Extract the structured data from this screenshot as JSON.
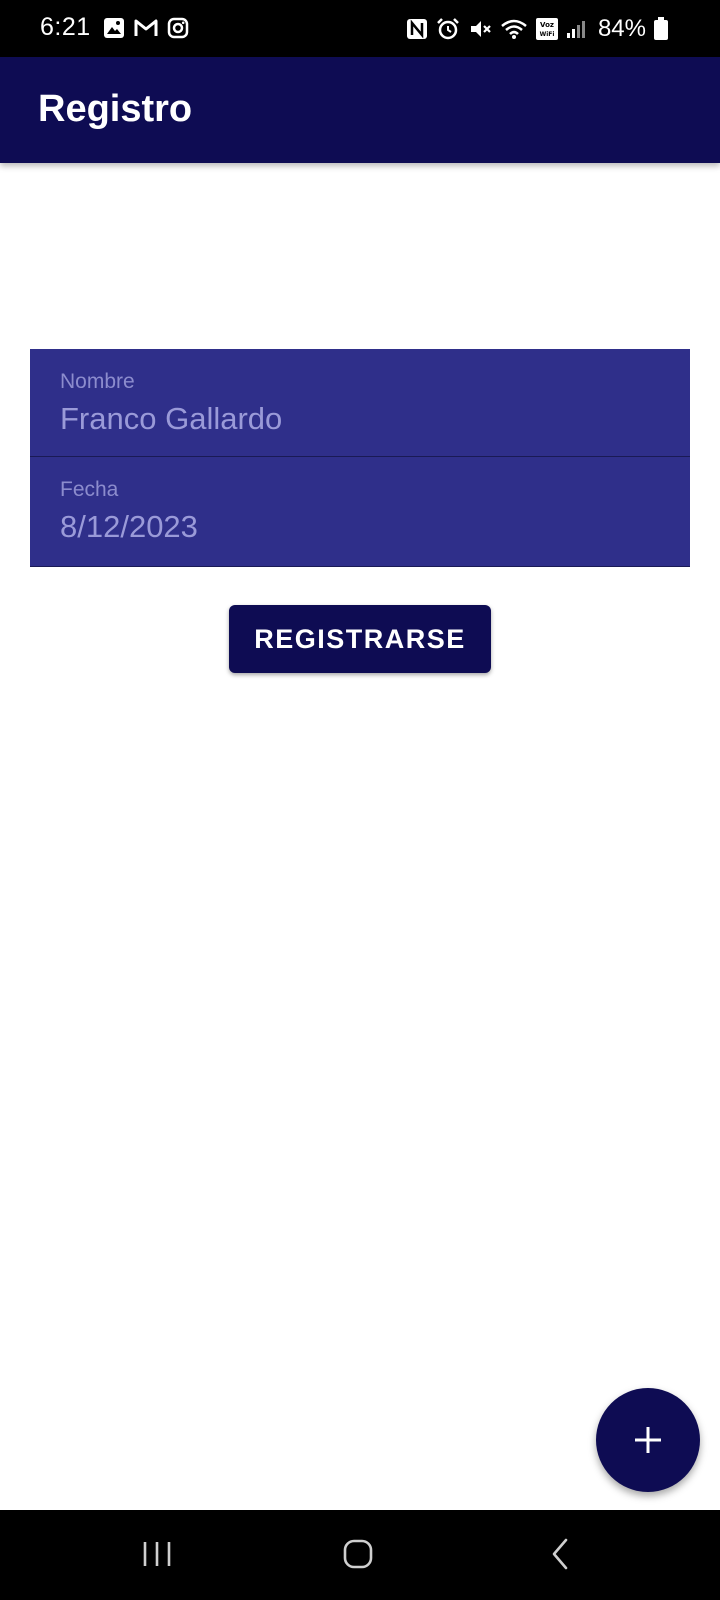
{
  "status_bar": {
    "time": "6:21",
    "battery_percent": "84%",
    "left_icons": [
      "gallery-icon",
      "gmail-icon",
      "instagram-icon"
    ],
    "right_icons": [
      "nfc-icon",
      "alarm-icon",
      "mute-icon",
      "wifi-icon",
      "voz-wifi-icon",
      "signal-icon",
      "battery-icon"
    ],
    "voz_wifi_text": "Voz WiFi"
  },
  "app_bar": {
    "title": "Registro"
  },
  "form": {
    "name_field": {
      "label": "Nombre",
      "value": "Franco Gallardo"
    },
    "date_field": {
      "label": "Fecha",
      "value": "8/12/2023"
    }
  },
  "register_button": {
    "label": "REGISTRARSE"
  },
  "fab": {
    "icon": "plus-icon"
  },
  "nav_bar": {
    "buttons": [
      "recents-icon",
      "home-icon",
      "back-icon"
    ]
  },
  "colors": {
    "primary": "#0e0c53",
    "field_background": "#2f2f8a",
    "field_text": "#9a9ad8",
    "background": "#ffffff"
  }
}
